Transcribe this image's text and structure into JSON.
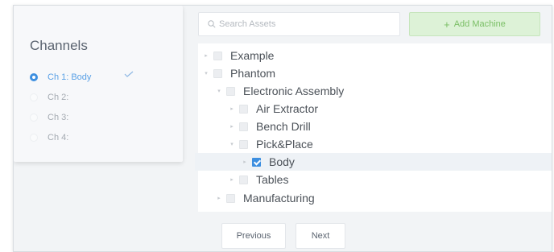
{
  "channels": {
    "title": "Channels",
    "items": [
      {
        "label": "Ch 1: Body",
        "selected": true
      },
      {
        "label": "Ch 2:",
        "selected": false
      },
      {
        "label": "Ch 3:",
        "selected": false
      },
      {
        "label": "Ch 4:",
        "selected": false
      }
    ]
  },
  "search": {
    "placeholder": "Search Assets"
  },
  "add_machine": {
    "icon": "+",
    "label": "Add Machine"
  },
  "tree": {
    "items": [
      {
        "label": "Example",
        "checked": false
      },
      {
        "label": "Phantom",
        "checked": false
      },
      {
        "label": "Electronic Assembly",
        "checked": false
      },
      {
        "label": "Air Extractor",
        "checked": false
      },
      {
        "label": "Bench Drill",
        "checked": false
      },
      {
        "label": "Pick&Place",
        "checked": false
      },
      {
        "label": "Body",
        "checked": true
      },
      {
        "label": "Tables",
        "checked": false
      },
      {
        "label": "Manufacturing",
        "checked": false
      }
    ]
  },
  "pager": {
    "previous": "Previous",
    "next": "Next"
  },
  "colors": {
    "accent": "#3d8fe0",
    "add_green": "#7bbf66"
  }
}
